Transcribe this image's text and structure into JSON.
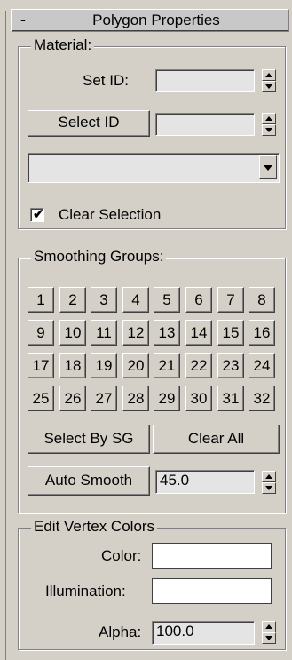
{
  "header": {
    "collapse_symbol": "-",
    "title": "Polygon Properties"
  },
  "material": {
    "label": "Material:",
    "set_id_label": "Set ID:",
    "set_id_value": "",
    "select_id_button": "Select ID",
    "select_id_value": "",
    "dropdown_value": "",
    "clear_selection_label": "Clear Selection",
    "clear_selection_checked": true
  },
  "smoothing": {
    "label": "Smoothing Groups:",
    "groups": [
      "1",
      "2",
      "3",
      "4",
      "5",
      "6",
      "7",
      "8",
      "9",
      "10",
      "11",
      "12",
      "13",
      "14",
      "15",
      "16",
      "17",
      "18",
      "19",
      "20",
      "21",
      "22",
      "23",
      "24",
      "25",
      "26",
      "27",
      "28",
      "29",
      "30",
      "31",
      "32"
    ],
    "select_by_sg": "Select By SG",
    "clear_all": "Clear All",
    "auto_smooth": "Auto Smooth",
    "auto_smooth_value": "45.0"
  },
  "vertex_colors": {
    "label": "Edit Vertex Colors",
    "color_label": "Color:",
    "color_value": "#ffffff",
    "illumination_label": "Illumination:",
    "illumination_value": "#ffffff",
    "alpha_label": "Alpha:",
    "alpha_value": "100.0"
  },
  "icons": [
    "collapse-icon",
    "spinner-up-icon",
    "spinner-down-icon",
    "dropdown-arrow-icon",
    "checkmark-icon"
  ]
}
